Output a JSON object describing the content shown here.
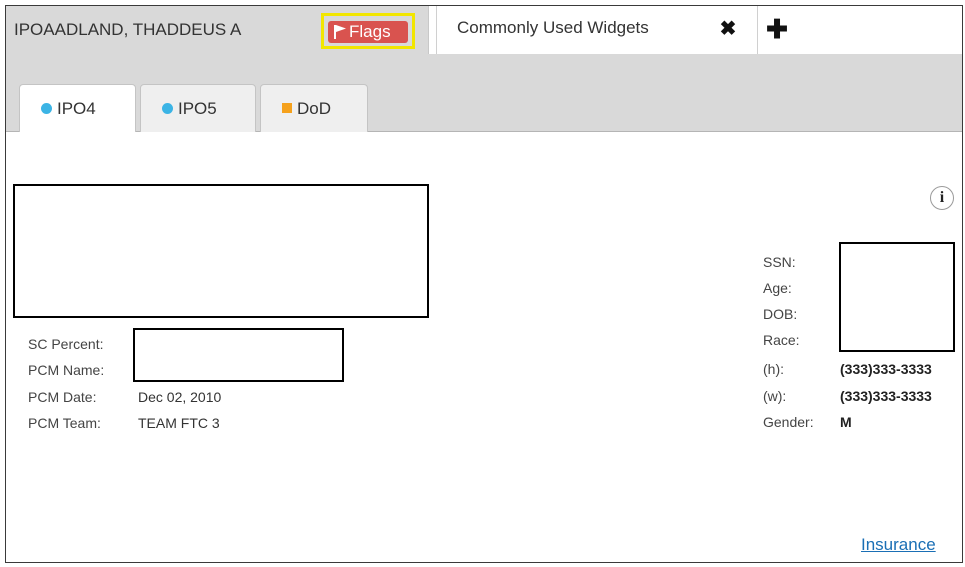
{
  "header": {
    "patient_name": "IPOAADLAND, THADDEUS A",
    "flags_label": "Flags",
    "widget_tab_label": "Commonly Used Widgets",
    "widget_close_glyph": "✖",
    "add_tab_glyph": "✚",
    "flags_color": "#d9534f",
    "highlight_color": "#f2e600"
  },
  "site_tabs": [
    {
      "label": "IPO4",
      "marker": "circle",
      "color": "#3bb4e5",
      "active": true
    },
    {
      "label": "IPO5",
      "marker": "circle",
      "color": "#3bb4e5",
      "active": false
    },
    {
      "label": "DoD",
      "marker": "square",
      "color": "#f5a11c",
      "active": false
    }
  ],
  "left_fields": {
    "sc_percent_label": "SC Percent:",
    "pcm_name_label": "PCM Name:",
    "pcm_date_label": "PCM Date:",
    "pcm_date_value": "Dec 02, 2010",
    "pcm_team_label": "PCM Team:",
    "pcm_team_value": "TEAM FTC 3"
  },
  "right_fields": {
    "ssn_label": "SSN:",
    "age_label": "Age:",
    "dob_label": "DOB:",
    "race_label": "Race:",
    "home_phone_label": "(h):",
    "home_phone_value": "(333)333-3333",
    "work_phone_label": "(w):",
    "work_phone_value": "(333)333-3333",
    "gender_label": "Gender:",
    "gender_value": "M"
  },
  "info_glyph": "i",
  "insurance_link": "Insurance"
}
